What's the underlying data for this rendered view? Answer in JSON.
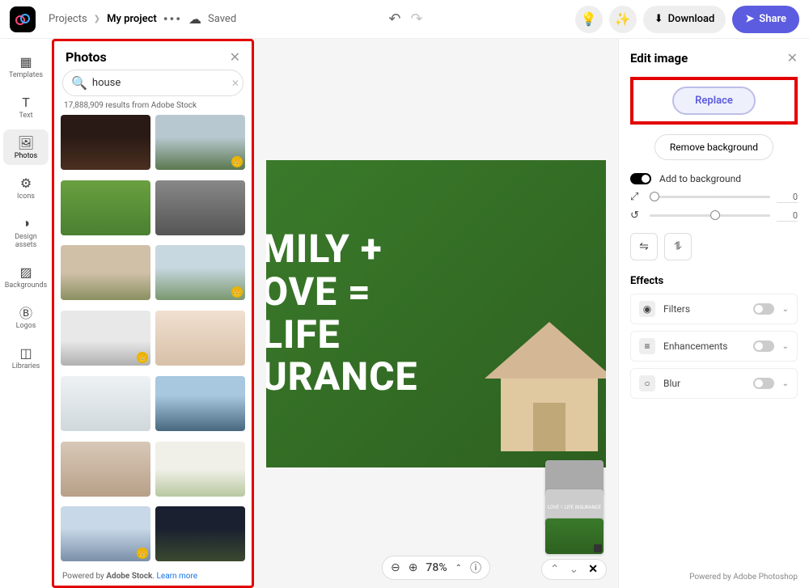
{
  "topbar": {
    "projects": "Projects",
    "project_name": "My project",
    "saved": "Saved",
    "download": "Download",
    "share": "Share"
  },
  "rail": {
    "items": [
      {
        "label": "Templates"
      },
      {
        "label": "Text"
      },
      {
        "label": "Photos"
      },
      {
        "label": "Icons"
      },
      {
        "label": "Design assets"
      },
      {
        "label": "Backgrounds"
      },
      {
        "label": "Logos"
      },
      {
        "label": "Libraries"
      }
    ]
  },
  "photos_panel": {
    "title": "Photos",
    "search_value": "house",
    "results_text": "17,888,909 results from Adobe Stock",
    "footer_prefix": "Powered by ",
    "footer_brand": "Adobe Stock",
    "footer_sep": ". ",
    "footer_link": "Learn more"
  },
  "canvas": {
    "line1": "MILY +",
    "line2": "OVE =",
    "line3": "LIFE",
    "line4": "URANCE",
    "layer_text": "LOVE = LIFE INSURANCE",
    "zoom": "78%"
  },
  "edit_panel": {
    "title": "Edit image",
    "replace": "Replace",
    "remove_bg": "Remove background",
    "add_bg": "Add to background",
    "scale_val": "0",
    "rotate_val": "0",
    "effects_label": "Effects",
    "filters": "Filters",
    "enhancements": "Enhancements",
    "blur": "Blur",
    "footer": "Powered by Adobe Photoshop"
  }
}
